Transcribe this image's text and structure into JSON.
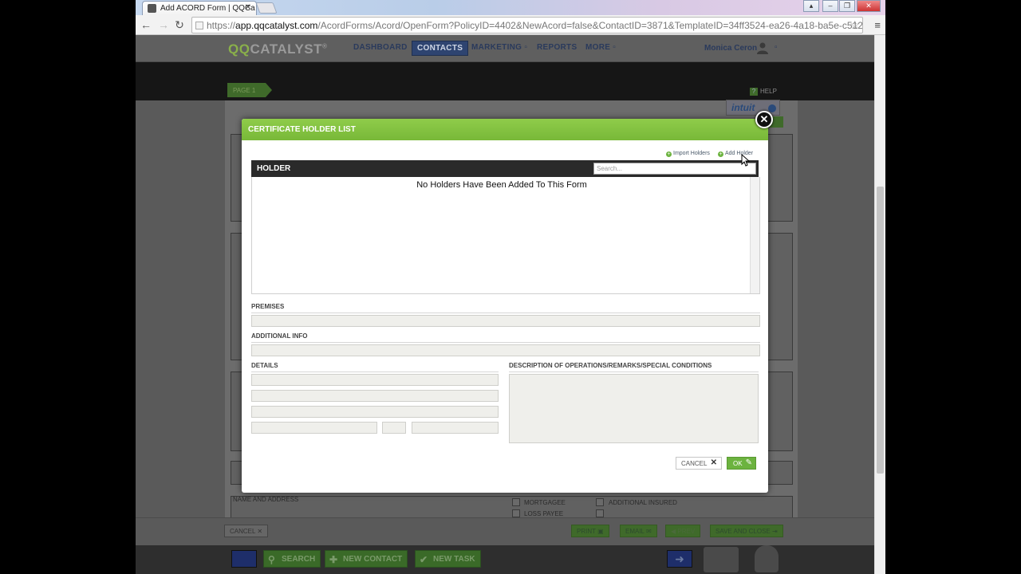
{
  "browser": {
    "tab_title": "Add ACORD Form | QQCa",
    "tab_close": "✕",
    "url_domain": "app.qqcatalyst.com",
    "url": "https://app.qqcatalyst.com/AcordForms/Acord/OpenForm?PolicyID=4402&NewAcord=false&ContactID=3871&TemplateID=34ff3524-ea26-4a18-ba5e-c512",
    "url_path": "/AcordForms/Acord/OpenForm?PolicyID=4402&NewAcord=false&ContactID=3871&TemplateID=34ff3524-ea26-4a18-ba5e-c512"
  },
  "app": {
    "logo_qq": "QQ",
    "logo_cat": "CATALYST",
    "logo_reg": "®",
    "nav": {
      "dashboard": "DASHBOARD",
      "contacts": "CONTACTS",
      "marketing": "MARKETING",
      "reports": "REPORTS",
      "more": "MORE"
    },
    "user_name": "Monica Ceron",
    "page_tab": "PAGE 1",
    "help": "HELP",
    "intuit": "intuit",
    "form_labels": {
      "name_and_address": "NAME AND ADDRESS",
      "mortgagee": "MORTGAGEE",
      "additional_insured": "ADDITIONAL INSURED",
      "loss_payee": "LOSS PAYEE"
    },
    "actions": {
      "cancel": "CANCEL",
      "print": "PRINT",
      "email": "EMAIL",
      "prev": "PREV",
      "save_and_close": "SAVE AND CLOSE"
    },
    "dock": {
      "search": "SEARCH",
      "new_contact": "NEW CONTACT",
      "new_task": "NEW TASK"
    }
  },
  "modal": {
    "title": "CERTIFICATE HOLDER LIST",
    "import_holders": "Import Holders",
    "add_holder": "Add Holder",
    "holder_header": "HOLDER",
    "search_placeholder": "Search...",
    "empty_message": "No Holders Have Been Added To This Form",
    "premises_label": "PREMISES",
    "additional_info_label": "ADDITIONAL INFO",
    "details_label": "DETAILS",
    "description_label": "DESCRIPTION OF OPERATIONS/REMARKS/SPECIAL CONDITIONS",
    "cancel": "CANCEL",
    "ok": "OK"
  },
  "colors": {
    "brand_green": "#78b838",
    "nav_active": "#2e4470"
  }
}
